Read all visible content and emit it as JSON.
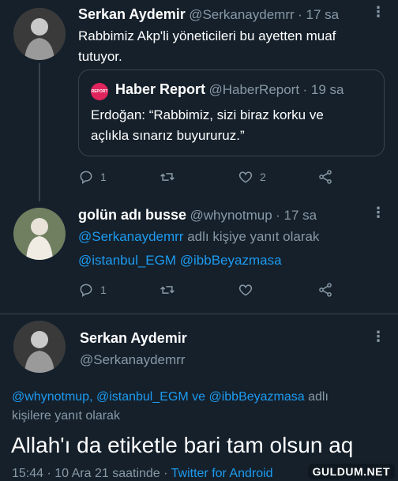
{
  "colors": {
    "background": "#15202b",
    "text": "#ffffff",
    "muted": "#8899a6",
    "link": "#1d9bf0",
    "border": "#38444d"
  },
  "tweet1": {
    "name": "Serkan Aydemir",
    "handle": "@Serkanaydemrr",
    "time": "· 17 sa",
    "text_line1": "Rabbimiz Akp'li yöneticileri bu ayetten muaf",
    "text_line2": "tutuyor.",
    "quote": {
      "logo_text": "REPORT",
      "name": "Haber Report",
      "handle": "@HaberReport",
      "time": "· 19 sa",
      "text_line1": "Erdoğan: “Rabbimiz, sizi biraz korku ve",
      "text_line2": "açlıkla sınarız buyururuz.”"
    },
    "reply_count": "1",
    "like_count": "2"
  },
  "tweet2": {
    "name": "golün adı busse",
    "handle": "@whynotmup",
    "time": "· 17 sa",
    "reply_to_handle": "@Serkanaydemrr",
    "reply_to_suffix": " adlı kişiye yanıt olarak",
    "line2_handle1": "@istanbul_EGM",
    "line2_handle2": "@ibbBeyazmasa",
    "reply_count": "1"
  },
  "tweet3": {
    "name": "Serkan Aydemir",
    "handle": "@Serkanaydemrr",
    "reply_handles": "@whynotmup, @istanbul_EGM ve @ibbBeyazmasa",
    "reply_suffix_a": " adlı",
    "reply_suffix_b": "kişilere yanıt olarak",
    "text": "Allah'ı da etiketle bari tam olsun aq",
    "timestamp": "15:44 · 10 Ara 21 saatinde ·",
    "source": "Twitter for Android"
  },
  "icons": [
    "reply-icon",
    "retweet-icon",
    "like-icon",
    "share-icon",
    "more-icon"
  ],
  "watermark": "GULDUM.NET"
}
